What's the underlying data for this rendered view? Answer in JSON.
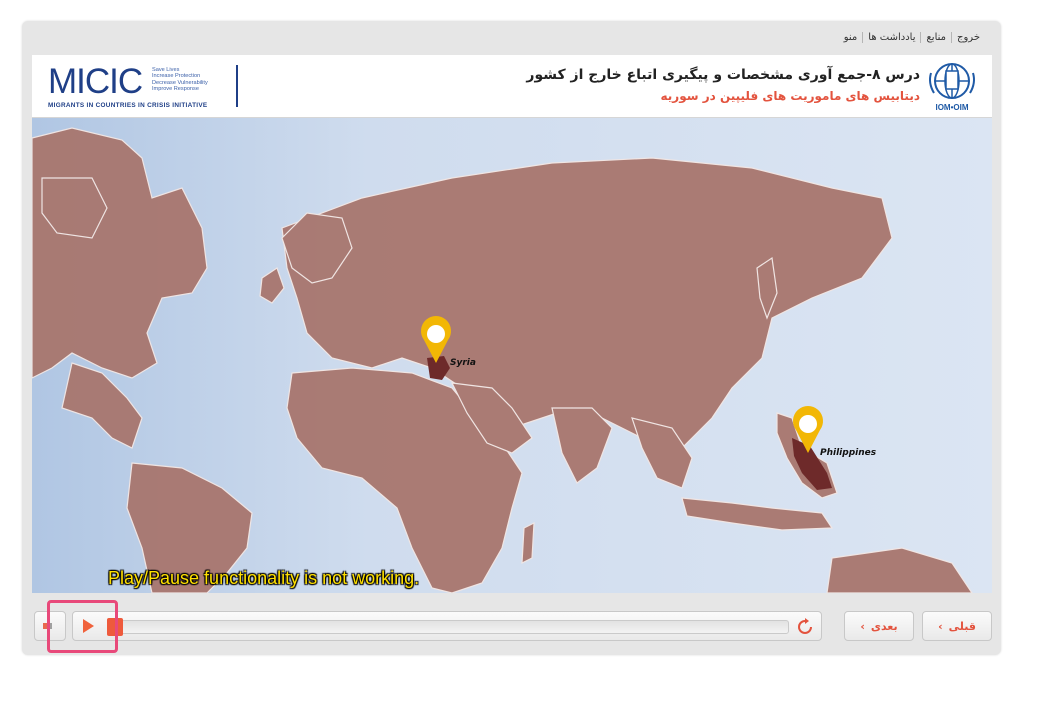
{
  "nav": {
    "exit": "خروج",
    "resources": "منابع",
    "notes": "یادداشت ها",
    "menu": "منو"
  },
  "header": {
    "micic_word": "MICIC",
    "micic_taglines": [
      "Save Lives",
      "Increase Protection",
      "Decrease Vulnerability",
      "Improve Response"
    ],
    "micic_subtitle": "MIGRANTS IN COUNTRIES IN CRISIS INITIATIVE",
    "title": "درس ۸-جمع آوری مشخصات و پیگیری اتباع خارج از کشور",
    "subtitle": "دیتابیس های ماموریت های فلیپین در سوریه",
    "iom_label": "IOM•OIM"
  },
  "map": {
    "pins": [
      {
        "label": "Syria"
      },
      {
        "label": "Philippines"
      }
    ],
    "pin_color": "#f2b705",
    "land_color": "#a8766e",
    "highlight_color": "#6e2a2a"
  },
  "annotation": "Play/Pause functionality is not working.",
  "controls": {
    "progress": 0.0,
    "next_label": "بعدی",
    "prev_label": "قبلی",
    "accent": "#ee5a3c"
  }
}
